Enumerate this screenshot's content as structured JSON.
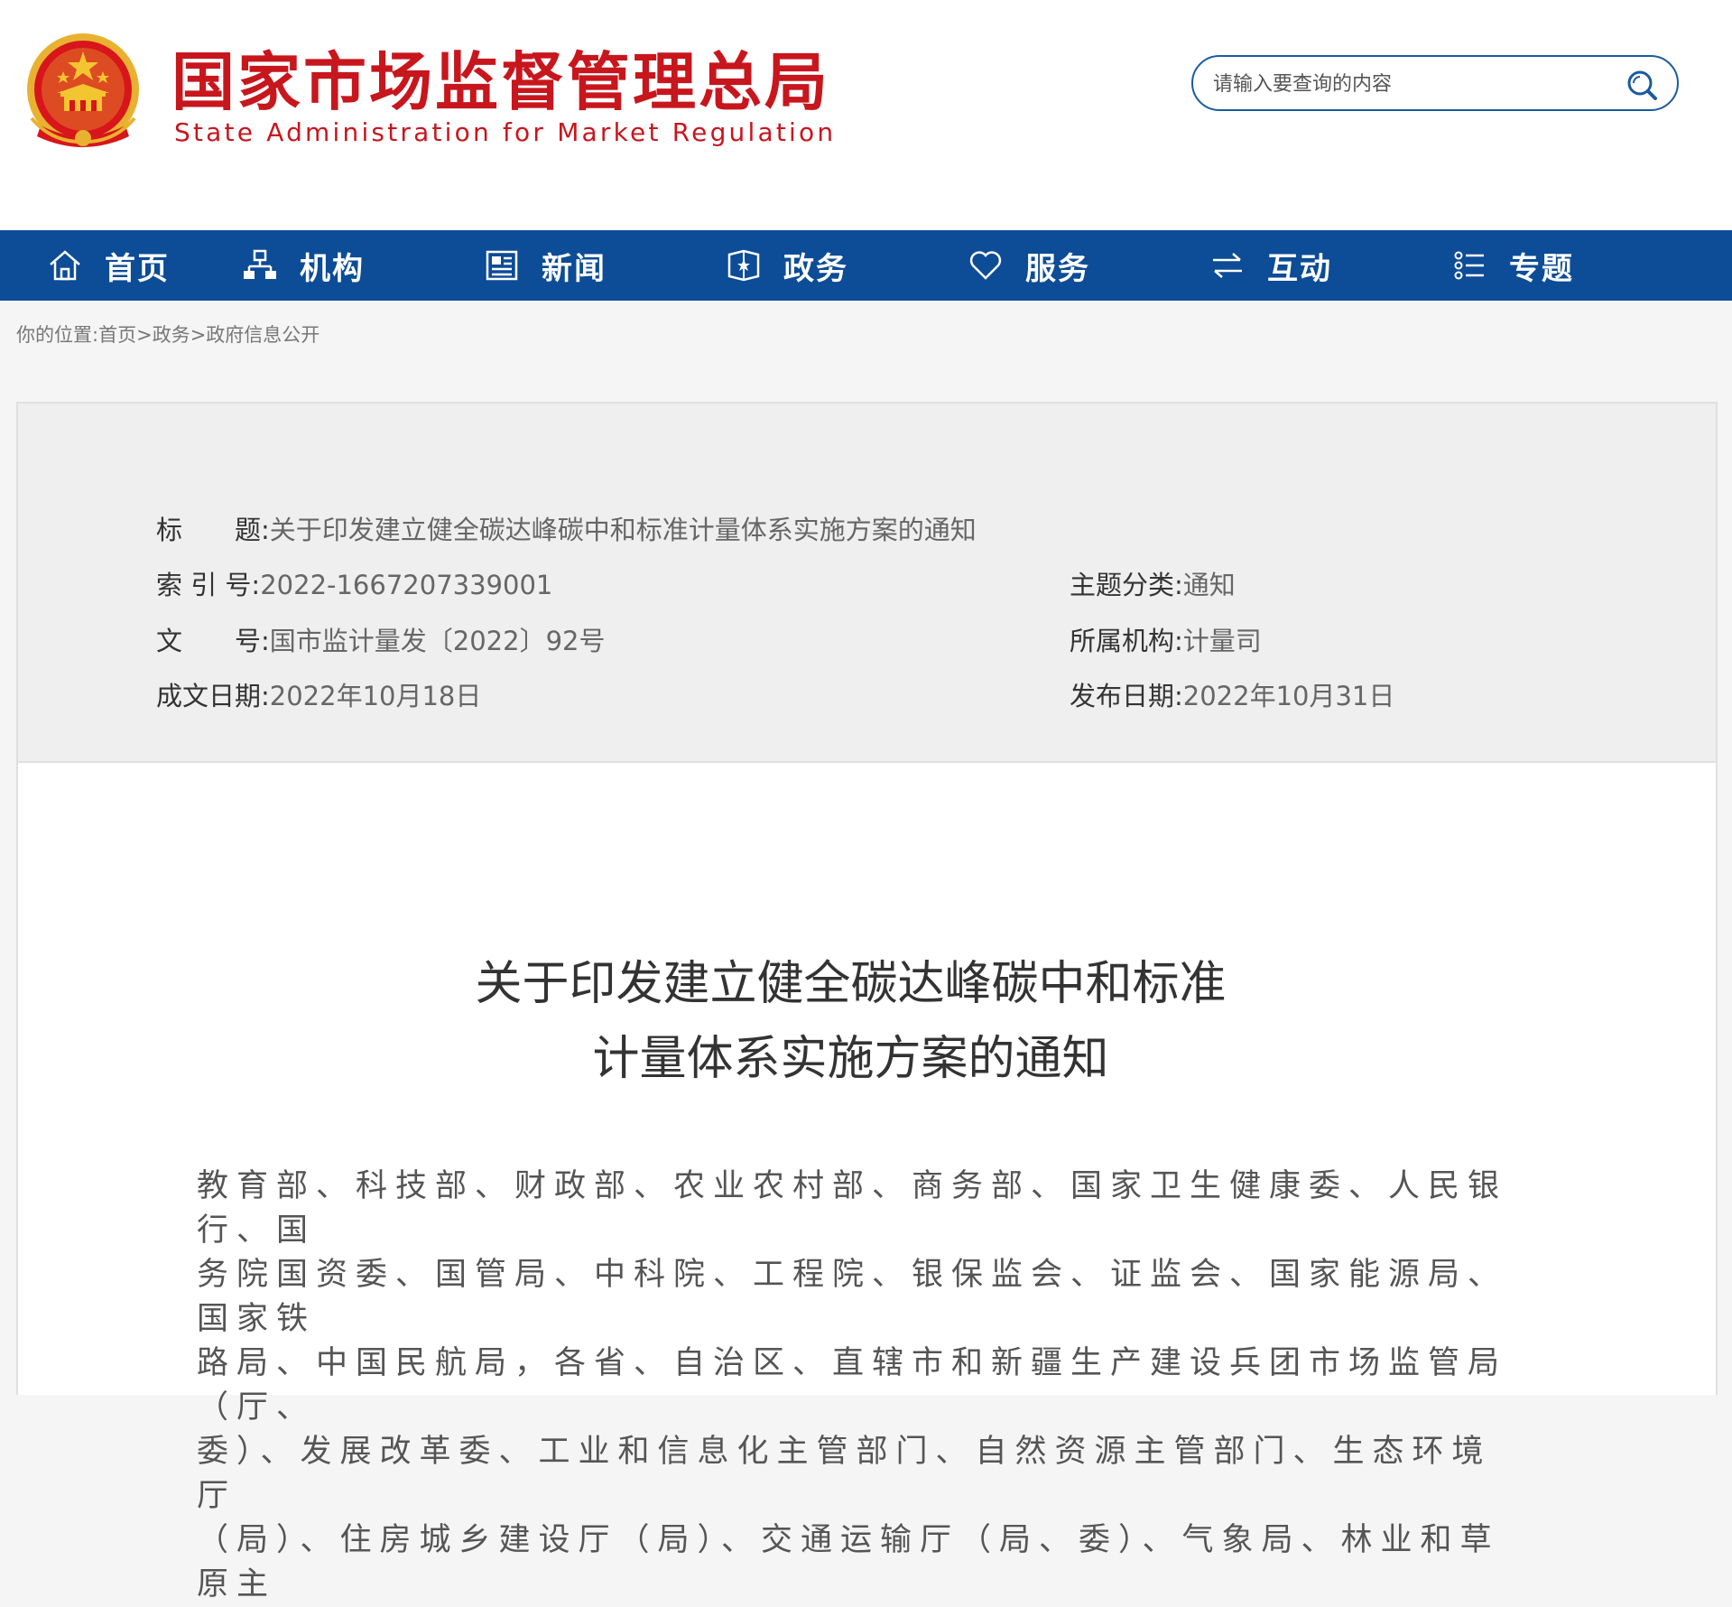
{
  "header": {
    "site_name_cn": "国家市场监督管理总局",
    "site_name_en": "State Administration for Market Regulation",
    "search_placeholder": "请输入要查询的内容"
  },
  "nav": {
    "items": [
      {
        "label": "首页",
        "icon": "home-icon"
      },
      {
        "label": "机构",
        "icon": "org-chart-icon"
      },
      {
        "label": "新闻",
        "icon": "newspaper-icon"
      },
      {
        "label": "政务",
        "icon": "shield-book-icon"
      },
      {
        "label": "服务",
        "icon": "heart-icon"
      },
      {
        "label": "互动",
        "icon": "exchange-arrows-icon"
      },
      {
        "label": "专题",
        "icon": "list-icon"
      }
    ]
  },
  "breadcrumb": {
    "prefix": "你的位置:",
    "items": [
      "首页",
      "政务",
      "政府信息公开"
    ],
    "separator": ">"
  },
  "meta": {
    "title_label": "标　　题:",
    "title_value": "关于印发建立健全碳达峰碳中和标准计量体系实施方案的通知",
    "index_label": "索 引 号:",
    "index_value": "2022-1667207339001",
    "topic_label": "主题分类:",
    "topic_value": "通知",
    "docno_label": "文　　号:",
    "docno_value": "国市监计量发〔2022〕92号",
    "org_label": "所属机构:",
    "org_value": "计量司",
    "written_label": "成文日期:",
    "written_value": "2022年10月18日",
    "published_label": "发布日期:",
    "published_value": "2022年10月31日"
  },
  "article": {
    "title_line1": "关于印发建立健全碳达峰碳中和标准",
    "title_line2": "计量体系实施方案的通知",
    "body_lines": [
      "教育部、科技部、财政部、农业农村部、商务部、国家卫生健康委、人民银行、国",
      "务院国资委、国管局、中科院、工程院、银保监会、证监会、国家能源局、国家铁",
      "路局、中国民航局，各省、自治区、直辖市和新疆生产建设兵团市场监管局（厅、",
      "委）、发展改革委、工业和信息化主管部门、自然资源主管部门、生态环境厅",
      "（局）、住房城乡建设厅（局）、交通运输厅（局、委）、气象局、林业和草原主"
    ]
  },
  "colors": {
    "brand_red": "#c8161d",
    "nav_blue": "#0d4c96",
    "search_border": "#1a5aa0"
  }
}
